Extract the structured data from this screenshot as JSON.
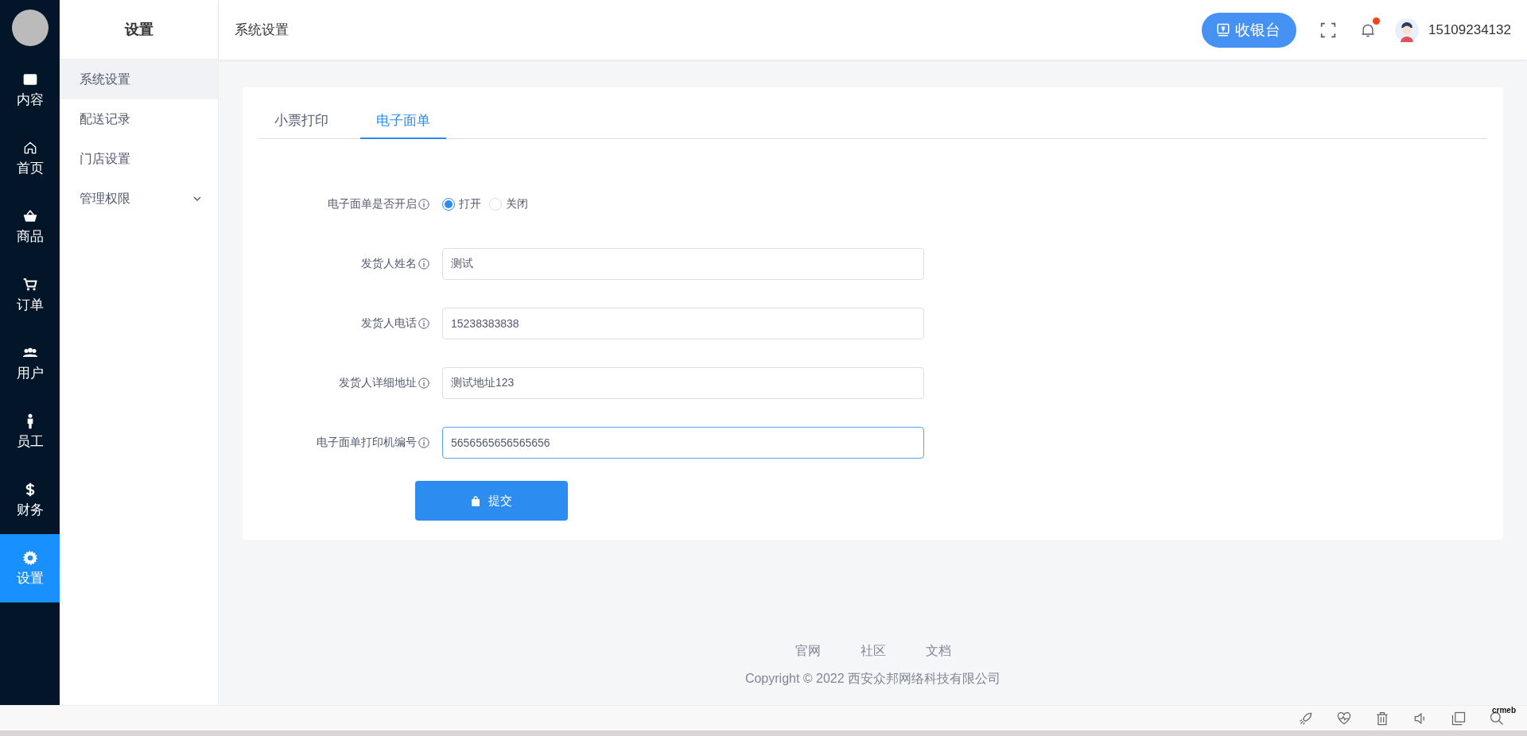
{
  "rail": {
    "items": [
      {
        "label": "内容",
        "selected": false
      },
      {
        "label": "首页",
        "selected": false
      },
      {
        "label": "商品",
        "selected": false
      },
      {
        "label": "订单",
        "selected": false
      },
      {
        "label": "用户",
        "selected": false
      },
      {
        "label": "员工",
        "selected": false
      },
      {
        "label": "财务",
        "selected": false
      },
      {
        "label": "设置",
        "selected": true
      }
    ]
  },
  "submenu": {
    "title": "设置",
    "items": [
      {
        "label": "系统设置",
        "selected": true,
        "kind": "link"
      },
      {
        "label": "配送记录",
        "selected": false,
        "kind": "link"
      },
      {
        "label": "门店设置",
        "selected": false,
        "kind": "link"
      },
      {
        "label": "管理权限",
        "selected": false,
        "kind": "group"
      }
    ]
  },
  "header": {
    "title": "系统设置",
    "cashier_button": "收银台",
    "unread": true,
    "user": "15109234132"
  },
  "tabs": [
    {
      "label": "小票打印",
      "selected": false
    },
    {
      "label": "电子面单",
      "selected": true
    }
  ],
  "form": {
    "fields": [
      {
        "kind": "radio",
        "label": "电子面单是否开启",
        "options": [
          {
            "label": "打开",
            "selected": true
          },
          {
            "label": "关闭",
            "selected": false
          }
        ]
      },
      {
        "kind": "text",
        "label": "发货人姓名",
        "value": "测试",
        "focused": false
      },
      {
        "kind": "text",
        "label": "发货人电话",
        "value": "15238383838",
        "focused": false
      },
      {
        "kind": "text",
        "label": "发货人详细地址",
        "value": "测试地址123",
        "focused": false
      },
      {
        "kind": "text",
        "label": "电子面单打印机编号",
        "value": "5656565656565656",
        "focused": true
      }
    ],
    "submit": "提交"
  },
  "footer": {
    "links": [
      "官网",
      "社区",
      "文档"
    ],
    "copyright": "Copyright © 2022 西安众邦网络科技有限公司"
  },
  "bottom_bar": {
    "badge": "crmeb"
  }
}
